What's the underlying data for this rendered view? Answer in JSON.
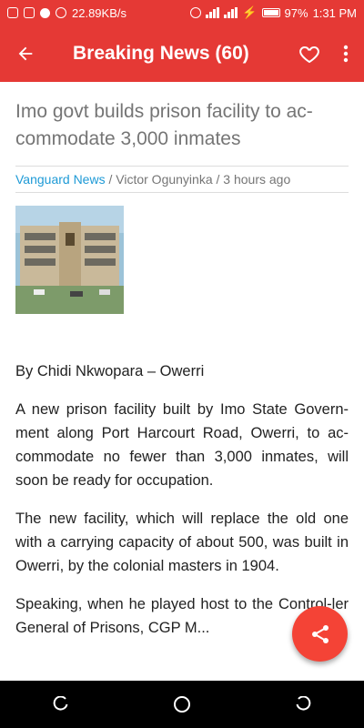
{
  "status_bar": {
    "speed": "22.89KB/s",
    "battery_pct": "97%",
    "time": "1:31 PM"
  },
  "app_bar": {
    "title": "Breaking News (60)"
  },
  "article": {
    "headline": "Imo govt builds prison facility to ac-commodate 3,000 inmates",
    "source": "Vanguard News",
    "separator": " / ",
    "author": "Victor Ogunyinka",
    "time_ago": "3 hours ago",
    "paragraphs": [
      "By Chidi Nkwopara – Owerri",
      "A new prison facility built by Imo State Govern-ment along Port Harcourt Road, Owerri, to ac-commodate no fewer than 3,000 inmates, will soon be ready for occupation.",
      "The new facility, which will replace the old one with a carrying capacity of about 500, was built in Owerri, by the colonial masters in 1904.",
      "Speaking, when he played host to the Control-ler General of Prisons, CGP M..."
    ]
  },
  "colors": {
    "accent": "#e53935",
    "fab": "#f44336",
    "link": "#1e9ad6"
  }
}
